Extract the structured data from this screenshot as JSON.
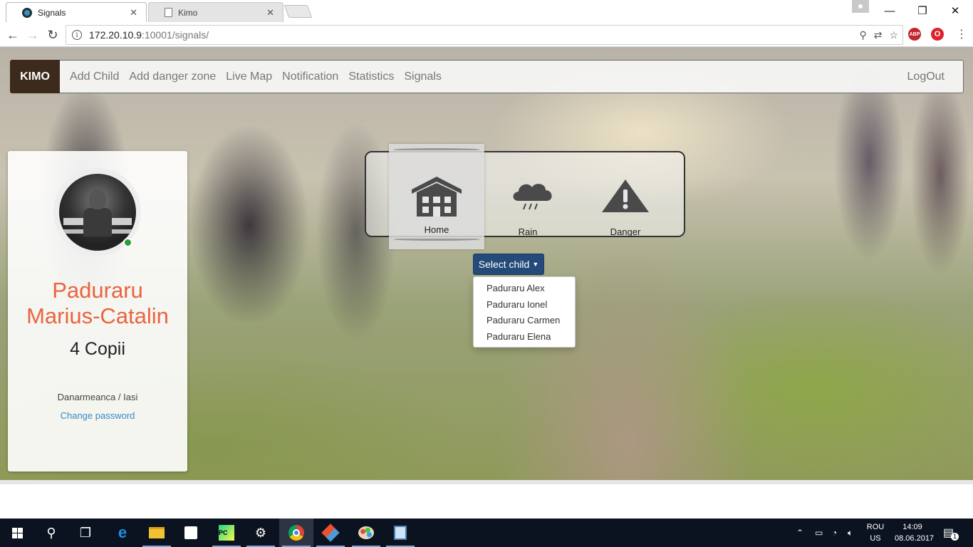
{
  "browser": {
    "tabs": [
      {
        "title": "Signals",
        "active": true
      },
      {
        "title": "Kimo",
        "active": false
      }
    ],
    "url_host": "172.20.10.9",
    "url_rest": ":10001/signals/"
  },
  "navbar": {
    "brand": "KIMO",
    "links": [
      "Add Child",
      "Add danger zone",
      "Live Map",
      "Notification",
      "Statistics",
      "Signals"
    ],
    "logout": "LogOut"
  },
  "profile": {
    "name_line1": "Paduraru",
    "name_line2": "Marius-Catalin",
    "children_count": "4 Copii",
    "location": "Danarmeanca / Iasi",
    "change_password": "Change password",
    "status_color": "#2e9b3a"
  },
  "signals": {
    "items": [
      {
        "label": "Home",
        "icon": "house-icon",
        "active": true
      },
      {
        "label": "Rain",
        "icon": "rain-cloud-icon",
        "active": false
      },
      {
        "label": "Danger",
        "icon": "warning-icon",
        "active": false
      }
    ]
  },
  "child_select": {
    "button_label": "Select child",
    "options": [
      "Paduraru Alex",
      "Paduraru Ionel",
      "Paduraru Carmen",
      "Paduraru Elena"
    ]
  },
  "taskbar": {
    "language": [
      "ROU",
      "US"
    ],
    "time": "14:09",
    "date": "08.06.2017",
    "notification_count": "1"
  },
  "colors": {
    "brand_bg": "#3c2a1c",
    "name_accent": "#e9643f",
    "button_bg": "#234a78",
    "link": "#3a88c8"
  }
}
